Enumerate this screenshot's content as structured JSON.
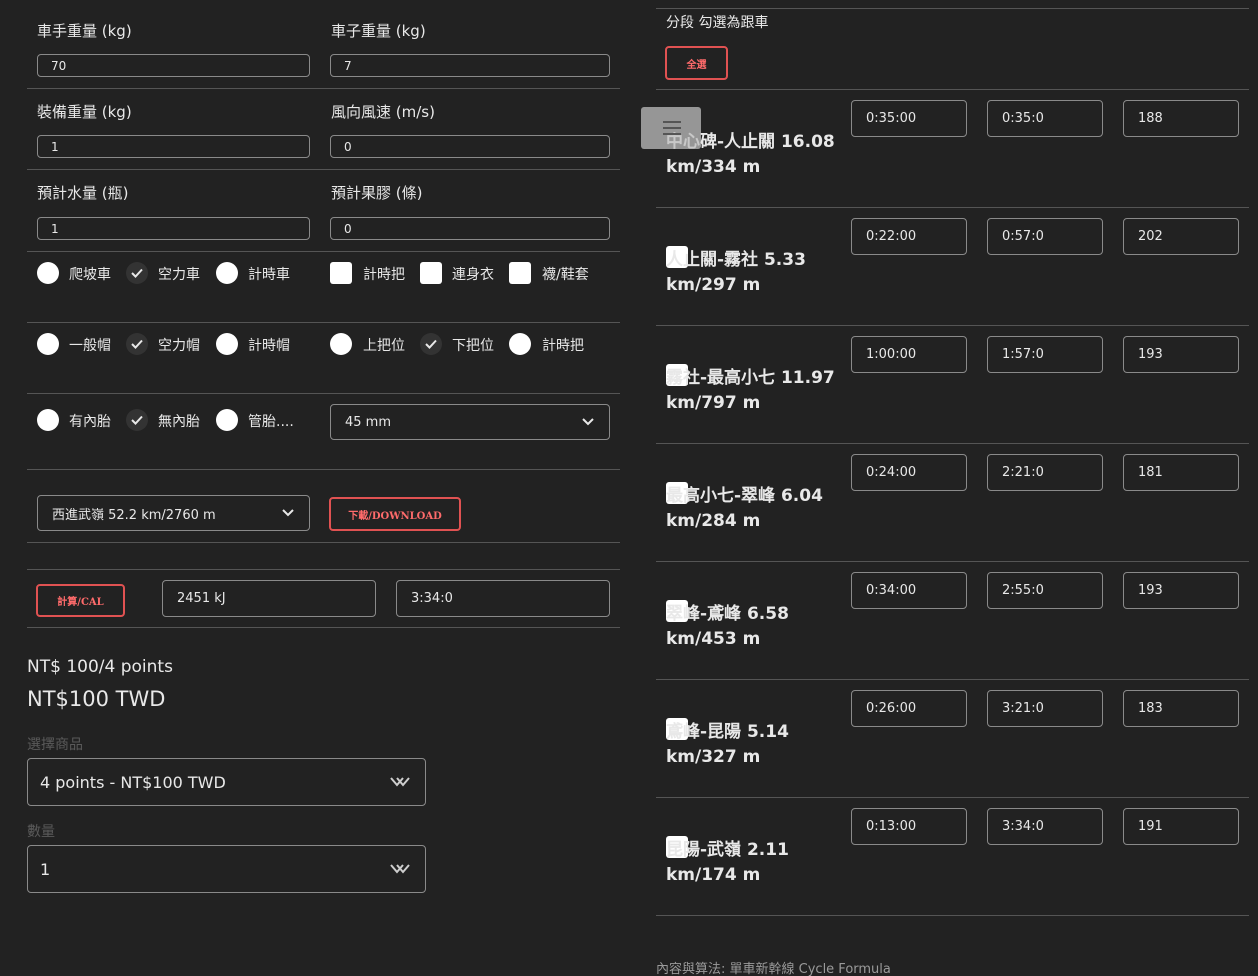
{
  "form": {
    "rider_weight": {
      "label": "車手重量 (kg)",
      "value": "70"
    },
    "bike_weight": {
      "label": "車子重量 (kg)",
      "value": "7"
    },
    "gear_weight": {
      "label": "裝備重量 (kg)",
      "value": "1"
    },
    "wind": {
      "label": "風向風速 (m/s)",
      "value": "0"
    },
    "water": {
      "label": "預計水量 (瓶)",
      "value": "1"
    },
    "gel": {
      "label": "預計果膠 (條)",
      "value": "0"
    }
  },
  "options": {
    "bike_types": [
      {
        "label": "爬坡車",
        "checked": false
      },
      {
        "label": "空力車",
        "checked": true
      },
      {
        "label": "計時車",
        "checked": false
      }
    ],
    "extras": [
      {
        "label": "計時把",
        "checked": false
      },
      {
        "label": "連身衣",
        "checked": false
      },
      {
        "label": "襪/鞋套",
        "checked": false
      }
    ],
    "helmets": [
      {
        "label": "一般帽",
        "checked": false
      },
      {
        "label": "空力帽",
        "checked": true
      },
      {
        "label": "計時帽",
        "checked": false
      }
    ],
    "positions": [
      {
        "label": "上把位",
        "checked": false
      },
      {
        "label": "下把位",
        "checked": true
      },
      {
        "label": "計時把",
        "checked": false
      }
    ],
    "tires": [
      {
        "label": "有內胎",
        "checked": false
      },
      {
        "label": "無內胎",
        "checked": true
      },
      {
        "label": "管胎....",
        "checked": false
      }
    ],
    "rim_depth": "45 mm"
  },
  "route": {
    "selected": "西進武嶺 52.2 km/2760 m",
    "download_label": "下載/DOWNLOAD"
  },
  "calc": {
    "button_label": "計算/CAL",
    "energy": "2451 kJ",
    "total_time": "3:34:0"
  },
  "shop": {
    "price_title": "NT$ 100/4 points",
    "price": "NT$100 TWD",
    "product_label": "選擇商品",
    "product_selected": "4 points - NT$100 TWD",
    "qty_label": "數量",
    "qty_selected": "1"
  },
  "segments": {
    "header": "分段 勾選為跟車",
    "select_all_label": "全選",
    "rows": [
      {
        "name": "中心碑-人止關 16.08 km/334 m",
        "time": "0:35:00",
        "cumulative": "0:35:0",
        "power": "188"
      },
      {
        "name": "人止關-霧社 5.33 km/297 m",
        "time": "0:22:00",
        "cumulative": "0:57:0",
        "power": "202"
      },
      {
        "name": "霧社-最高小七 11.97 km/797 m",
        "time": "1:00:00",
        "cumulative": "1:57:0",
        "power": "193"
      },
      {
        "name": "最高小七-翠峰 6.04 km/284 m",
        "time": "0:24:00",
        "cumulative": "2:21:0",
        "power": "181"
      },
      {
        "name": "翠峰-鳶峰 6.58 km/453 m",
        "time": "0:34:00",
        "cumulative": "2:55:0",
        "power": "193"
      },
      {
        "name": "鳶峰-昆陽 5.14 km/327 m",
        "time": "0:26:00",
        "cumulative": "3:21:0",
        "power": "183"
      },
      {
        "name": "昆陽-武嶺 2.11 km/174 m",
        "time": "0:13:00",
        "cumulative": "3:34:0",
        "power": "191"
      }
    ]
  },
  "footer": "內容與算法: 單車新幹線 Cycle Formula",
  "icons": {
    "menu": "menu-icon",
    "check": "check-icon",
    "chevron": "chevron-down-icon"
  },
  "colors": {
    "background": "#222222",
    "accent": "#e05252"
  }
}
